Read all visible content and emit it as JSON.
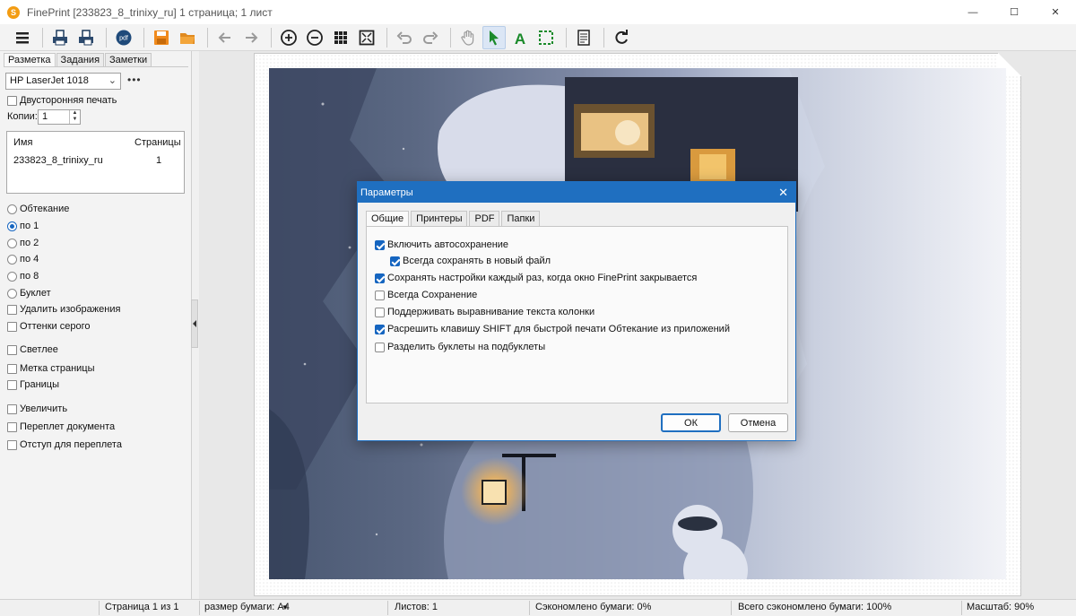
{
  "window": {
    "title": "FinePrint [233823_8_trinixy_ru] 1 страница; 1 лист",
    "app_icon_letter": "S",
    "minimize": "—",
    "maximize": "☐",
    "close": "✕"
  },
  "toolbar": {
    "buttons": [
      "menu-icon",
      "print-icon",
      "print-settings-icon",
      "pdf-icon",
      "save-icon",
      "open-folder-icon",
      "arrow-left-icon",
      "arrow-right-icon",
      "zoom-in-icon",
      "zoom-out-icon",
      "grid-icon",
      "fit-page-icon",
      "undo-icon",
      "redo-icon",
      "hand-icon",
      "pointer-icon",
      "text-icon",
      "select-rect-icon",
      "notes-icon",
      "refresh-icon"
    ]
  },
  "left": {
    "tabs": [
      "Разметка",
      "Задания",
      "Заметки"
    ],
    "printer": "HP LaserJet 1018",
    "more": "•••",
    "duplex": "Двусторонняя печать",
    "copies_label": "Копии:",
    "copies_value": "1",
    "list_head_name": "Имя",
    "list_head_pages": "Страницы",
    "job_name": "233823_8_trinixy_ru",
    "job_pages": "1",
    "layouts": [
      "Обтекание",
      "по 1",
      "по 2",
      "по 4",
      "по 8",
      "Буклет"
    ],
    "selected_layout": "по 1",
    "options_a": [
      "Удалить изображения",
      "Оттенки серого"
    ],
    "options_b": [
      "Светлее",
      "Метка страницы",
      "Границы"
    ],
    "options_c": [
      "Увеличить",
      "Переплет документа",
      "Отступ для переплета"
    ]
  },
  "dialog": {
    "title": "Параметры",
    "close": "✕",
    "tabs": [
      "Общие",
      "Принтеры",
      "PDF",
      "Папки"
    ],
    "options": [
      {
        "label": "Включить автосохранение",
        "checked": true
      },
      {
        "label": "Всегда сохранять в новый файл",
        "checked": true
      },
      {
        "label": "Сохранять настройки каждый раз, когда окно FinePrint закрывается",
        "checked": true
      },
      {
        "label": "Всегда Сохранение",
        "checked": false
      },
      {
        "label": "Поддерживать выравнивание текста колонки",
        "checked": false
      },
      {
        "label": "Расрешить клавишу SHIFT для быстрой печати Обтекание из приложений",
        "checked": true
      },
      {
        "label": "Разделить буклеты на подбуклеты",
        "checked": false
      }
    ],
    "ok": "ОК",
    "cancel": "Отмена"
  },
  "status": {
    "page": "Страница 1 из 1",
    "paper": "размер бумаги: A4",
    "sheets": "Листов: 1",
    "saved": "Сэкономлено бумаги: 0%",
    "total_saved": "Всего сэкономлено бумаги: 100%",
    "zoom": "Масштаб: 90%"
  }
}
